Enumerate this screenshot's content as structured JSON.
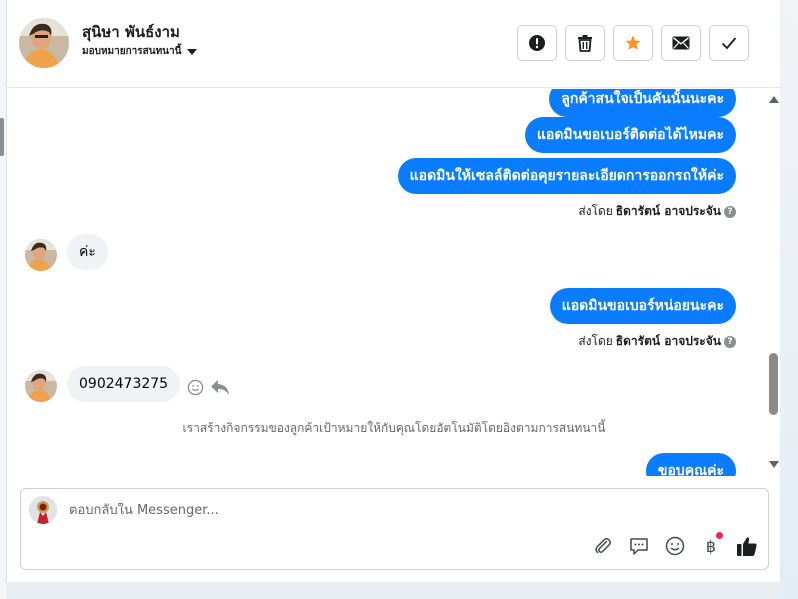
{
  "header": {
    "contact_name": "สุนิษา พันธ์งาม",
    "assign_label": "มอบหมายการสนทนานี้",
    "actions": [
      "report-icon",
      "trash-icon",
      "star-icon",
      "envelope-icon",
      "check-icon"
    ],
    "star_color": "#f7931e"
  },
  "messages": {
    "out1": "ลูกค้าสนใจเป็นคันนั้นนะคะ",
    "out2": "แอดมินขอเบอร์ติดต่อได้ไหมคะ",
    "out3": "แอดมินให้เซลล์ติดต่อคุยรายละเอียดการออกรถให้ค่ะ",
    "sent_by_prefix_1": "ส่งโดย",
    "sent_by_name_1": "ธิดารัตน์ อาจประจัน",
    "in1": "ค่ะ",
    "out4": "แอดมินขอเบอร์หน่อยนะคะ",
    "sent_by_prefix_2": "ส่งโดย",
    "sent_by_name_2": "ธิดารัตน์ อาจประจัน",
    "in2": "0902473275",
    "system_note": "เราสร้างกิจกรรมของลูกค้าเป้าหมายให้กับคุณโดยอัตโนมัติโดยอิงตามการสนทนานี้",
    "out5": "ขอบคุณค่ะ",
    "help_glyph": "?"
  },
  "composer": {
    "placeholder": "ตอบกลับใน Messenger...",
    "baht_glyph": "฿"
  },
  "colors": {
    "outgoing_bubble": "#0a7cff",
    "incoming_bubble": "#f0f2f5",
    "notification_dot": "#f02849"
  }
}
